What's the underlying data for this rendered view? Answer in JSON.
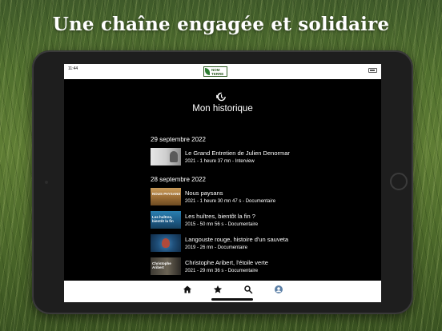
{
  "headline": "Une chaîne engagée et solidaire",
  "status_bar": {
    "time": "11:44"
  },
  "app": {
    "logo_line1": "NOM",
    "logo_line2": "TERRE"
  },
  "history": {
    "title": "Mon historique",
    "icon": "history-icon",
    "groups": [
      {
        "date": "29 septembre 2022",
        "items": [
          {
            "title": "Le Grand Entretien de Julien Denormar",
            "meta": "2021 - 1 heure 37 mn  - Interview"
          }
        ]
      },
      {
        "date": "28 septembre 2022",
        "items": [
          {
            "title": "Nous paysans",
            "meta": "2021 - 1 heure 30 mn 47 s  - Documentaire",
            "thumb_text": "NOUS PAYSANS"
          },
          {
            "title": "Les huîtres, bientôt la fin ?",
            "meta": "2015 - 50 mn 56 s  - Documentaire",
            "thumb_text": "Les huîtres, bientôt la fin"
          },
          {
            "title": "Langouste rouge, histoire d'un sauveta",
            "meta": "2019 - 26 mn  - Documentaire"
          },
          {
            "title": "Christophe Aribert, l'étoile verte",
            "meta": "2021 - 29 mn 36 s  - Documentaire",
            "thumb_text": "Christophe Aribert"
          }
        ]
      }
    ]
  },
  "tabs": [
    {
      "icon": "home-icon"
    },
    {
      "icon": "star-icon"
    },
    {
      "icon": "search-icon"
    },
    {
      "icon": "profile-icon"
    }
  ],
  "colors": {
    "screen_bg": "#000000",
    "accent_green": "#2e5c23"
  }
}
